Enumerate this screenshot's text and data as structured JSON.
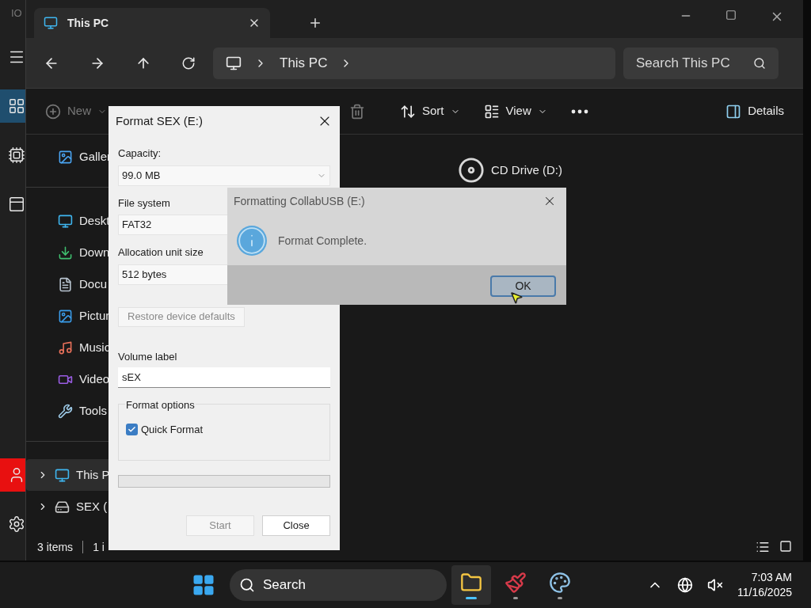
{
  "background_app": {
    "label": "IO",
    "rail": [
      {
        "kind": "menu",
        "selected": false
      },
      {
        "kind": "grid",
        "selected": true
      },
      {
        "kind": "chip",
        "selected": false
      },
      {
        "kind": "panel",
        "selected": false
      },
      {
        "kind": "user",
        "alert": true
      },
      {
        "kind": "settings",
        "selected": false
      }
    ]
  },
  "explorer": {
    "tabs": [
      {
        "label": "This PC",
        "selected": true
      }
    ],
    "breadcrumb": [
      "This PC"
    ],
    "search": {
      "placeholder": "Search This PC"
    },
    "commands": [
      {
        "label": "New",
        "kind": "new",
        "disabled": true
      },
      {
        "kind": "delete",
        "disabled": true
      },
      {
        "label": "Sort",
        "kind": "sort",
        "disabled": false
      },
      {
        "label": "View",
        "kind": "view",
        "disabled": false
      },
      {
        "kind": "more",
        "disabled": false
      },
      {
        "label": "Details",
        "kind": "details",
        "disabled": false
      }
    ],
    "sidebar": {
      "groups": [
        [
          {
            "label": "Galler",
            "kind": "gallery",
            "selected": false
          }
        ],
        [
          {
            "label": "Deskt",
            "kind": "desktop",
            "selected": false
          },
          {
            "label": "Down",
            "kind": "downloads",
            "selected": false
          },
          {
            "label": "Docu",
            "kind": "documents",
            "selected": false
          },
          {
            "label": "Pictur",
            "kind": "pictures",
            "selected": false
          },
          {
            "label": "Music",
            "kind": "music",
            "selected": false
          },
          {
            "label": "Video",
            "kind": "videos",
            "selected": false
          },
          {
            "label": "Tools",
            "kind": "tools",
            "selected": false
          }
        ],
        [
          {
            "label": "This P",
            "kind": "pc",
            "selected": true,
            "expandable": true
          },
          {
            "label": "SEX (",
            "kind": "drive",
            "selected": false,
            "expandable": true
          }
        ]
      ]
    },
    "drives": [
      {
        "name": "CD Drive (D:)",
        "kind": "cd"
      }
    ],
    "status": [
      "3 items",
      "1 i"
    ]
  },
  "format_dialog": {
    "title": "Format SEX (E:)",
    "selects": [
      {
        "label": "Capacity:",
        "value": "99.0 MB"
      },
      {
        "label": "File system",
        "value": "FAT32"
      },
      {
        "label": "Allocation unit size",
        "value": "512 bytes"
      }
    ],
    "restore_button": {
      "label": "Restore device defaults",
      "disabled": true
    },
    "volume_label": {
      "label": "Volume label",
      "value": "sEX"
    },
    "options": {
      "legend": "Format options",
      "items": [
        {
          "label": "Quick Format",
          "checked": true
        }
      ]
    },
    "progress": {
      "level": 0
    },
    "buttons": [
      {
        "label": "Start",
        "disabled": true
      },
      {
        "label": "Close",
        "disabled": false
      }
    ]
  },
  "message_box": {
    "title": "Formatting CollabUSB (E:)",
    "message": "Format Complete.",
    "button": "OK"
  },
  "taskbar": {
    "search": "Search",
    "apps": [
      {
        "kind": "explorer",
        "selected": true,
        "running": true
      },
      {
        "kind": "tool",
        "selected": false,
        "running": true
      },
      {
        "kind": "paint",
        "selected": false,
        "running": true
      }
    ],
    "time": "7:03 AM",
    "date": "11/16/2025"
  }
}
